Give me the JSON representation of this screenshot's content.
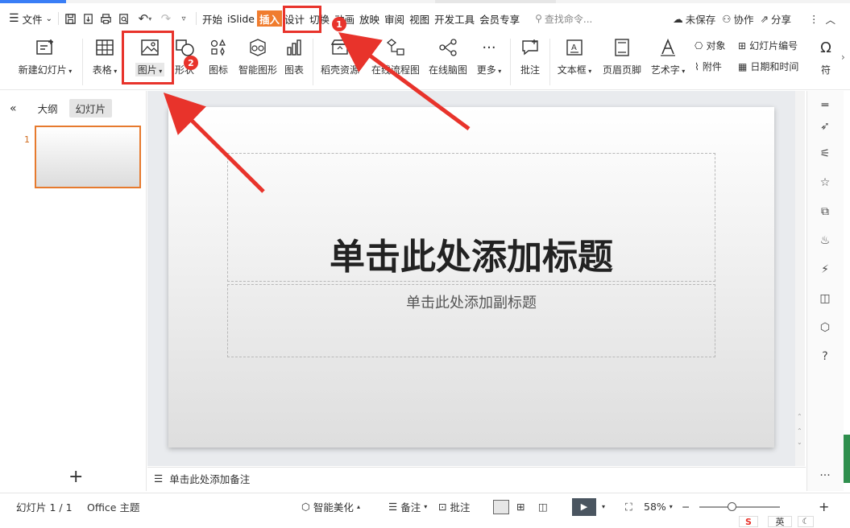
{
  "menubar": {
    "file_label": "文件",
    "tabs": [
      "开始",
      "iSlide",
      "插入",
      "设计",
      "切换",
      "动画",
      "放映",
      "审阅",
      "视图",
      "开发工具",
      "会员专享"
    ],
    "active_tab": "插入",
    "search_placeholder": "查找命令...",
    "unsaved": "未保存",
    "collab": "协作",
    "share": "分享"
  },
  "ribbon": {
    "new_slide": "新建幻灯片",
    "table": "表格",
    "picture": "图片",
    "shape": "形状",
    "icon": "图标",
    "smart_graphic": "智能图形",
    "chart": "图表",
    "daoke": "稻壳资源",
    "flowchart": "在线流程图",
    "mindmap": "在线脑图",
    "more": "更多",
    "comment": "批注",
    "textbox": "文本框",
    "header_footer": "页眉页脚",
    "wordart": "艺术字",
    "object": "对象",
    "attachment": "附件",
    "slide_number": "幻灯片编号",
    "datetime": "日期和时间",
    "symbol": "符"
  },
  "badges": {
    "b1": "1",
    "b2": "2"
  },
  "leftpanel": {
    "outline_tab": "大纲",
    "slides_tab": "幻灯片",
    "slide_num": "1"
  },
  "slide": {
    "title": "单击此处添加标题",
    "subtitle": "单击此处添加副标题"
  },
  "notes": {
    "placeholder": "单击此处添加备注"
  },
  "status": {
    "slide_info": "幻灯片 1 / 1",
    "theme": "Office 主题",
    "beautify": "智能美化",
    "notes": "备注",
    "comment": "批注",
    "zoom": "58%",
    "zoom_fraction": 0.58
  },
  "tray": {
    "ime": "英"
  },
  "colors": {
    "accent": "#f07c2e",
    "highlight": "#e8332b",
    "selection": "#e67a2e"
  }
}
